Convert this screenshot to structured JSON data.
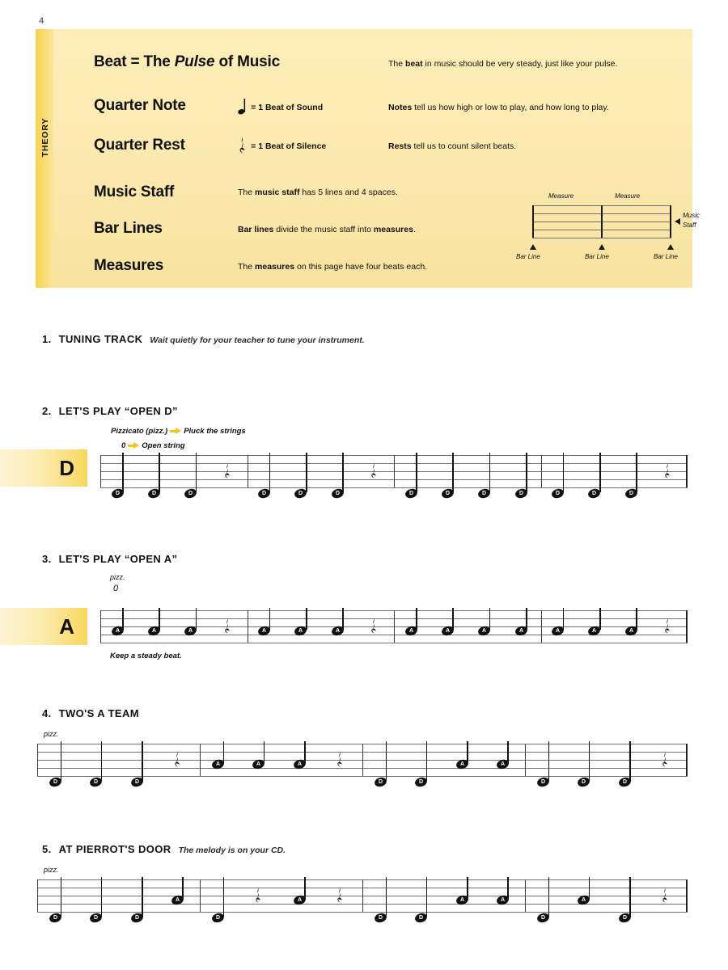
{
  "page": {
    "number": "4"
  },
  "theory": {
    "tab_label": "THEORY",
    "rows": [
      {
        "term": "Beat = The ",
        "term_italic": "Pulse",
        "term_tail": " of Music",
        "symbol": "",
        "symbol_text": "",
        "desc_pre": "The ",
        "desc_bold": "beat",
        "desc_post": " in music should be very steady, just like your pulse."
      },
      {
        "term": "Quarter Note",
        "term_italic": "",
        "term_tail": "",
        "symbol": "quarter-note",
        "symbol_text": "= 1 Beat of Sound",
        "desc_pre": "",
        "desc_bold": "Notes",
        "desc_post": " tell us how high or low to play, and how long to play."
      },
      {
        "term": "Quarter Rest",
        "term_italic": "",
        "term_tail": "",
        "symbol": "quarter-rest",
        "symbol_text": "= 1 Beat of Silence",
        "desc_pre": "",
        "desc_bold": "Rests",
        "desc_post": " tell us to count silent beats."
      },
      {
        "term": "Music Staff",
        "term_italic": "",
        "term_tail": "",
        "symbol": "",
        "symbol_text": "",
        "desc_pre": "The ",
        "desc_bold": "music staff",
        "desc_post": " has 5 lines and 4 spaces."
      },
      {
        "term": "Bar Lines",
        "term_italic": "",
        "term_tail": "",
        "symbol": "",
        "symbol_text": "",
        "desc_pre": "",
        "desc_bold": "Bar lines",
        "desc_post": " divide the music staff into ",
        "desc_bold2": "measures",
        "desc_post2": "."
      },
      {
        "term": "Measures",
        "term_italic": "",
        "term_tail": "",
        "symbol": "",
        "symbol_text": "",
        "desc_pre": "The ",
        "desc_bold": "measures",
        "desc_post": " on this page have four beats each."
      }
    ],
    "diagram": {
      "measure_label_1": "Measure",
      "measure_label_2": "Measure",
      "barline_label_1": "Bar Line",
      "barline_label_2": "Bar Line",
      "barline_label_3": "Bar Line",
      "staff_label_line1": "Music",
      "staff_label_line2": "Staff"
    }
  },
  "exercises": [
    {
      "number": "1.",
      "title": "TUNING TRACK",
      "subtitle": "Wait quietly for your teacher to tune your instrument.",
      "string_tag": "",
      "annotations": [],
      "caption": "",
      "measures": []
    },
    {
      "number": "2.",
      "title": "LET'S PLAY “OPEN D”",
      "subtitle": "",
      "string_tag": "D",
      "annotations": [
        {
          "text_before": "Pizzicato (pizz.)",
          "arrow": true,
          "text_after": "Pluck the strings"
        },
        {
          "text_before": "0",
          "arrow": true,
          "text_after": "Open string"
        }
      ],
      "caption": "",
      "measures": [
        [
          "D",
          "D",
          "D",
          "rest"
        ],
        [
          "D",
          "D",
          "D",
          "rest"
        ],
        [
          "D",
          "D",
          "D",
          "D"
        ],
        [
          "D",
          "D",
          "D",
          "rest"
        ]
      ]
    },
    {
      "number": "3.",
      "title": "LET'S PLAY “OPEN A”",
      "subtitle": "",
      "string_tag": "A",
      "annotations": [
        {
          "text_before": "pizz.",
          "arrow": false,
          "text_after": ""
        },
        {
          "text_before": "0",
          "arrow": false,
          "text_after": ""
        }
      ],
      "caption": "Keep a steady beat.",
      "measures": [
        [
          "A",
          "A",
          "A",
          "rest"
        ],
        [
          "A",
          "A",
          "A",
          "rest"
        ],
        [
          "A",
          "A",
          "A",
          "A"
        ],
        [
          "A",
          "A",
          "A",
          "rest"
        ]
      ]
    },
    {
      "number": "4.",
      "title": "TWO'S A TEAM",
      "subtitle": "",
      "string_tag": "",
      "annotations": [
        {
          "text_before": "pizz.",
          "arrow": false,
          "text_after": ""
        }
      ],
      "caption": "",
      "measures": [
        [
          "D",
          "D",
          "D",
          "rest"
        ],
        [
          "A",
          "A",
          "A",
          "rest"
        ],
        [
          "D",
          "D",
          "A",
          "A"
        ],
        [
          "D",
          "D",
          "D",
          "rest"
        ]
      ]
    },
    {
      "number": "5.",
      "title": "AT PIERROT'S DOOR",
      "subtitle": "The melody is on your CD.",
      "string_tag": "",
      "annotations": [
        {
          "text_before": "pizz.",
          "arrow": false,
          "text_after": ""
        }
      ],
      "caption": "",
      "measures": [
        [
          "D",
          "D",
          "D",
          "A"
        ],
        [
          "D",
          "rest",
          "A",
          "rest"
        ],
        [
          "D",
          "D",
          "A",
          "A"
        ],
        [
          "D",
          "A",
          "D",
          "rest"
        ]
      ]
    }
  ],
  "colors": {
    "theory_bg": "#fbe9ae",
    "theory_tab": "#f6d250",
    "string_tag_gold": "#f8d75e",
    "arrow_yellow": "#f5c518",
    "staff_line": "#6f6f6f",
    "ink": "#111111"
  }
}
